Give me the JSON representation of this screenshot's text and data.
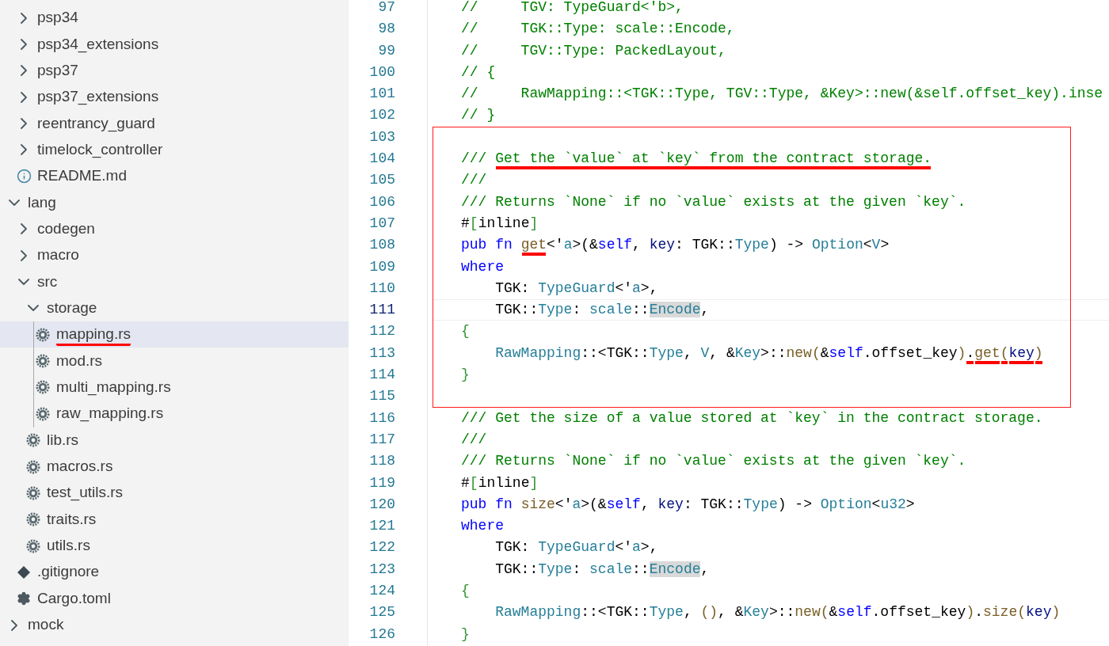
{
  "sidebar": {
    "tree": [
      {
        "kind": "folder",
        "children": [
          {
            "kind": "folder",
            "label": "psp34",
            "expanded": false,
            "selected": false
          },
          {
            "kind": "folder",
            "label": "psp34_extensions",
            "expanded": false,
            "selected": false
          },
          {
            "kind": "folder",
            "label": "psp37",
            "expanded": false,
            "selected": false
          },
          {
            "kind": "folder",
            "label": "psp37_extensions",
            "expanded": false,
            "selected": false
          },
          {
            "kind": "folder",
            "label": "reentrancy_guard",
            "expanded": false,
            "selected": false
          },
          {
            "kind": "folder",
            "label": "timelock_controller",
            "expanded": false,
            "selected": false
          },
          {
            "kind": "info",
            "label": "README.md",
            "selected": false
          }
        ]
      },
      {
        "kind": "folder",
        "label": "lang",
        "expanded": true,
        "selected": false,
        "children": [
          {
            "kind": "folder",
            "label": "codegen",
            "expanded": false,
            "selected": false
          },
          {
            "kind": "folder",
            "label": "macro",
            "expanded": false,
            "selected": false
          },
          {
            "kind": "folder",
            "label": "src",
            "expanded": true,
            "selected": false,
            "children": [
              {
                "kind": "folder",
                "label": "storage",
                "expanded": true,
                "selected": false,
                "children": [
                  {
                    "kind": "rust",
                    "label": "mapping.rs",
                    "selected": true,
                    "underlined": true
                  },
                  {
                    "kind": "rust",
                    "label": "mod.rs",
                    "selected": false
                  },
                  {
                    "kind": "rust",
                    "label": "multi_mapping.rs",
                    "selected": false
                  },
                  {
                    "kind": "rust",
                    "label": "raw_mapping.rs",
                    "selected": false
                  }
                ]
              },
              {
                "kind": "rust",
                "label": "lib.rs",
                "selected": false
              },
              {
                "kind": "rust",
                "label": "macros.rs",
                "selected": false
              },
              {
                "kind": "rust",
                "label": "test_utils.rs",
                "selected": false
              },
              {
                "kind": "rust",
                "label": "traits.rs",
                "selected": false
              },
              {
                "kind": "rust",
                "label": "utils.rs",
                "selected": false
              }
            ]
          },
          {
            "kind": "git",
            "label": ".gitignore",
            "selected": false
          },
          {
            "kind": "gear",
            "label": "Cargo.toml",
            "selected": false
          }
        ]
      },
      {
        "kind": "folder",
        "label": "mock",
        "expanded": false,
        "selected": false
      }
    ]
  },
  "editor": {
    "sections": [
      {
        "boxed": false,
        "lines": [
          {
            "number": "97",
            "current": false,
            "tokens": [
              {
                "text": "//     TGV: TypeGuard<'b>,",
                "kind": "comment"
              }
            ]
          },
          {
            "number": "98",
            "current": false,
            "tokens": [
              {
                "text": "//     TGK::Type: scale::Encode,",
                "kind": "comment"
              }
            ]
          },
          {
            "number": "99",
            "current": false,
            "tokens": [
              {
                "text": "//     TGV::Type: PackedLayout,",
                "kind": "comment"
              }
            ]
          },
          {
            "number": "100",
            "current": false,
            "tokens": [
              {
                "text": "// {",
                "kind": "comment"
              }
            ]
          },
          {
            "number": "101",
            "current": false,
            "tokens": [
              {
                "text": "//     RawMapping::<TGK::Type, TGV::Type, &Key>::new(&self.offset_key).inse",
                "kind": "comment"
              }
            ]
          },
          {
            "number": "102",
            "current": false,
            "tokens": [
              {
                "text": "// }",
                "kind": "comment"
              }
            ]
          }
        ]
      },
      {
        "boxed": true,
        "lines": [
          {
            "number": "103",
            "current": false
          },
          {
            "number": "104",
            "current": false,
            "tokens": [
              {
                "text": "/// ",
                "kind": "comment"
              },
              {
                "text": "Get the `value` at `key` from the contract storage.",
                "kind": "comment",
                "underlined": true
              }
            ]
          },
          {
            "number": "105",
            "current": false,
            "tokens": [
              {
                "text": "///",
                "kind": "comment"
              }
            ]
          },
          {
            "number": "106",
            "current": false,
            "tokens": [
              {
                "text": "/// Returns `None` if no `value` exists at the given `key`.",
                "kind": "comment"
              }
            ]
          },
          {
            "number": "107",
            "current": false,
            "tokens": [
              {
                "text": "#",
                "kind": "plain"
              },
              {
                "text": "[",
                "kind": "brace"
              },
              {
                "text": "inline",
                "kind": "plain"
              },
              {
                "text": "]",
                "kind": "brace"
              }
            ]
          },
          {
            "number": "108",
            "current": false,
            "tokens": [
              {
                "text": "pub fn ",
                "kind": "keyword"
              },
              {
                "text": "get",
                "kind": "function",
                "underlined": true
              },
              {
                "text": "<'",
                "kind": "plain"
              },
              {
                "text": "a",
                "kind": "type"
              },
              {
                "text": ">(&",
                "kind": "plain"
              },
              {
                "text": "self",
                "kind": "keyword"
              },
              {
                "text": ", ",
                "kind": "plain"
              },
              {
                "text": "key",
                "kind": "variable"
              },
              {
                "text": ": TGK::",
                "kind": "plain"
              },
              {
                "text": "Type",
                "kind": "type"
              },
              {
                "text": ") -> ",
                "kind": "plain"
              },
              {
                "text": "Option",
                "kind": "type"
              },
              {
                "text": "<",
                "kind": "plain"
              },
              {
                "text": "V",
                "kind": "type"
              },
              {
                "text": ">",
                "kind": "plain"
              }
            ]
          },
          {
            "number": "109",
            "current": false,
            "tokens": [
              {
                "text": "where",
                "kind": "keyword"
              }
            ]
          },
          {
            "number": "110",
            "current": false,
            "tokens": [
              {
                "text": "    TGK: ",
                "kind": "plain"
              },
              {
                "text": "TypeGuard",
                "kind": "type"
              },
              {
                "text": "<'",
                "kind": "plain"
              },
              {
                "text": "a",
                "kind": "type"
              },
              {
                "text": ">,",
                "kind": "plain"
              }
            ]
          },
          {
            "number": "111",
            "current": true,
            "tokens": [
              {
                "text": "    TGK::",
                "kind": "plain"
              },
              {
                "text": "Type",
                "kind": "type"
              },
              {
                "text": ": ",
                "kind": "plain"
              },
              {
                "text": "scale",
                "kind": "type"
              },
              {
                "text": "::",
                "kind": "plain"
              },
              {
                "text": "Encode",
                "kind": "type",
                "highlighted": true
              },
              {
                "text": ",",
                "kind": "plain"
              }
            ]
          },
          {
            "number": "112",
            "current": false,
            "tokens": [
              {
                "text": "{",
                "kind": "brace"
              }
            ]
          },
          {
            "number": "113",
            "current": false,
            "tokens": [
              {
                "text": "    RawMapping",
                "kind": "type"
              },
              {
                "text": "::<TGK::",
                "kind": "plain"
              },
              {
                "text": "Type",
                "kind": "type"
              },
              {
                "text": ", ",
                "kind": "plain"
              },
              {
                "text": "V",
                "kind": "type"
              },
              {
                "text": ", &",
                "kind": "plain"
              },
              {
                "text": "Key",
                "kind": "type"
              },
              {
                "text": ">::",
                "kind": "plain"
              },
              {
                "text": "new",
                "kind": "function"
              },
              {
                "text": "(",
                "kind": "bracket"
              },
              {
                "text": "&",
                "kind": "plain"
              },
              {
                "text": "self",
                "kind": "keyword"
              },
              {
                "text": ".offset_key",
                "kind": "plain"
              },
              {
                "text": ")",
                "kind": "bracket"
              },
              {
                "text": ".",
                "kind": "plain",
                "underlined": true
              },
              {
                "text": "get",
                "kind": "function",
                "underlined": true
              },
              {
                "text": "(",
                "kind": "bracket",
                "underlined": true
              },
              {
                "text": "key",
                "kind": "variable",
                "underlined": true
              },
              {
                "text": ")",
                "kind": "bracket",
                "underlined": true
              }
            ]
          },
          {
            "number": "114",
            "current": false,
            "tokens": [
              {
                "text": "}",
                "kind": "brace"
              }
            ]
          },
          {
            "number": "115",
            "current": false
          }
        ]
      },
      {
        "boxed": false,
        "lines": [
          {
            "number": "116",
            "current": false,
            "tokens": [
              {
                "text": "/// Get the size of a value stored at `key` in the contract storage.",
                "kind": "comment"
              }
            ]
          },
          {
            "number": "117",
            "current": false,
            "tokens": [
              {
                "text": "///",
                "kind": "comment"
              }
            ]
          },
          {
            "number": "118",
            "current": false,
            "tokens": [
              {
                "text": "/// Returns `None` if no `value` exists at the given `key`.",
                "kind": "comment"
              }
            ]
          },
          {
            "number": "119",
            "current": false,
            "tokens": [
              {
                "text": "#",
                "kind": "plain"
              },
              {
                "text": "[",
                "kind": "brace"
              },
              {
                "text": "inline",
                "kind": "plain"
              },
              {
                "text": "]",
                "kind": "brace"
              }
            ]
          },
          {
            "number": "120",
            "current": false,
            "tokens": [
              {
                "text": "pub fn ",
                "kind": "keyword"
              },
              {
                "text": "size",
                "kind": "function"
              },
              {
                "text": "<'",
                "kind": "plain"
              },
              {
                "text": "a",
                "kind": "type"
              },
              {
                "text": ">(&",
                "kind": "plain"
              },
              {
                "text": "self",
                "kind": "keyword"
              },
              {
                "text": ", ",
                "kind": "plain"
              },
              {
                "text": "key",
                "kind": "variable"
              },
              {
                "text": ": TGK::",
                "kind": "plain"
              },
              {
                "text": "Type",
                "kind": "type"
              },
              {
                "text": ") -> ",
                "kind": "plain"
              },
              {
                "text": "Option",
                "kind": "type"
              },
              {
                "text": "<",
                "kind": "plain"
              },
              {
                "text": "u32",
                "kind": "type"
              },
              {
                "text": ">",
                "kind": "plain"
              }
            ]
          },
          {
            "number": "121",
            "current": false,
            "tokens": [
              {
                "text": "where",
                "kind": "keyword"
              }
            ]
          },
          {
            "number": "122",
            "current": false,
            "tokens": [
              {
                "text": "    TGK: ",
                "kind": "plain"
              },
              {
                "text": "TypeGuard",
                "kind": "type"
              },
              {
                "text": "<'",
                "kind": "plain"
              },
              {
                "text": "a",
                "kind": "type"
              },
              {
                "text": ">,",
                "kind": "plain"
              }
            ]
          },
          {
            "number": "123",
            "current": false,
            "tokens": [
              {
                "text": "    TGK::",
                "kind": "plain"
              },
              {
                "text": "Type",
                "kind": "type"
              },
              {
                "text": ": ",
                "kind": "plain"
              },
              {
                "text": "scale",
                "kind": "type"
              },
              {
                "text": "::",
                "kind": "plain"
              },
              {
                "text": "Encode",
                "kind": "type",
                "highlighted": true
              },
              {
                "text": ",",
                "kind": "plain"
              }
            ]
          },
          {
            "number": "124",
            "current": false,
            "tokens": [
              {
                "text": "{",
                "kind": "brace"
              }
            ]
          },
          {
            "number": "125",
            "current": false,
            "tokens": [
              {
                "text": "    RawMapping",
                "kind": "type"
              },
              {
                "text": "::<TGK::",
                "kind": "plain"
              },
              {
                "text": "Type",
                "kind": "type"
              },
              {
                "text": ", ",
                "kind": "plain"
              },
              {
                "text": "()",
                "kind": "bracket"
              },
              {
                "text": ", &",
                "kind": "plain"
              },
              {
                "text": "Key",
                "kind": "type"
              },
              {
                "text": ">::",
                "kind": "plain"
              },
              {
                "text": "new",
                "kind": "function"
              },
              {
                "text": "(",
                "kind": "bracket"
              },
              {
                "text": "&",
                "kind": "plain"
              },
              {
                "text": "self",
                "kind": "keyword"
              },
              {
                "text": ".offset_key",
                "kind": "plain"
              },
              {
                "text": ")",
                "kind": "bracket"
              },
              {
                "text": ".",
                "kind": "plain"
              },
              {
                "text": "size",
                "kind": "function"
              },
              {
                "text": "(",
                "kind": "bracket"
              },
              {
                "text": "key",
                "kind": "variable"
              },
              {
                "text": ")",
                "kind": "bracket"
              }
            ]
          },
          {
            "number": "126",
            "current": false,
            "tokens": [
              {
                "text": "}",
                "kind": "brace"
              }
            ]
          }
        ]
      }
    ]
  }
}
